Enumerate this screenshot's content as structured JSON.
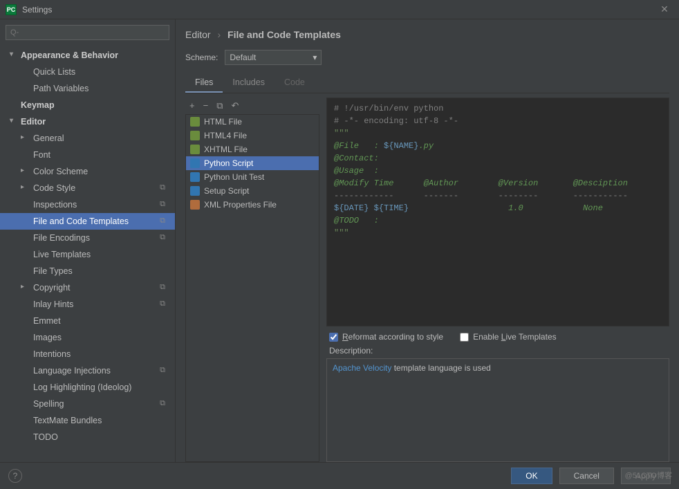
{
  "window": {
    "title": "Settings"
  },
  "search": {
    "placeholder": "Q-"
  },
  "sidebar": {
    "items": [
      {
        "label": "Appearance & Behavior",
        "level": 0,
        "exp": true
      },
      {
        "label": "Quick Lists",
        "level": 2
      },
      {
        "label": "Path Variables",
        "level": 2
      },
      {
        "label": "Keymap",
        "level": 0
      },
      {
        "label": "Editor",
        "level": 0,
        "exp": true
      },
      {
        "label": "General",
        "level": 1,
        "exp": true
      },
      {
        "label": "Font",
        "level": 2
      },
      {
        "label": "Color Scheme",
        "level": 1,
        "exp": true
      },
      {
        "label": "Code Style",
        "level": 1,
        "exp": true,
        "badge": "⧉"
      },
      {
        "label": "Inspections",
        "level": 2,
        "badge": "⧉"
      },
      {
        "label": "File and Code Templates",
        "level": 2,
        "badge": "⧉",
        "selected": true
      },
      {
        "label": "File Encodings",
        "level": 2,
        "badge": "⧉"
      },
      {
        "label": "Live Templates",
        "level": 2
      },
      {
        "label": "File Types",
        "level": 2
      },
      {
        "label": "Copyright",
        "level": 1,
        "exp": true,
        "badge": "⧉"
      },
      {
        "label": "Inlay Hints",
        "level": 2,
        "badge": "⧉"
      },
      {
        "label": "Emmet",
        "level": 2
      },
      {
        "label": "Images",
        "level": 2
      },
      {
        "label": "Intentions",
        "level": 2
      },
      {
        "label": "Language Injections",
        "level": 2,
        "badge": "⧉"
      },
      {
        "label": "Log Highlighting (Ideolog)",
        "level": 2
      },
      {
        "label": "Spelling",
        "level": 2,
        "badge": "⧉"
      },
      {
        "label": "TextMate Bundles",
        "level": 2
      },
      {
        "label": "TODO",
        "level": 2
      }
    ]
  },
  "breadcrumb": {
    "root": "Editor",
    "current": "File and Code Templates"
  },
  "scheme": {
    "label": "Scheme:",
    "value": "Default"
  },
  "tabs": [
    {
      "label": "Files",
      "active": true
    },
    {
      "label": "Includes"
    },
    {
      "label": "Code",
      "disabled": true
    }
  ],
  "toolbar": {
    "add": "+",
    "remove": "−",
    "copy": "⧉",
    "undo": "↶"
  },
  "files": [
    {
      "label": "HTML File",
      "icon": "html"
    },
    {
      "label": "HTML4 File",
      "icon": "html"
    },
    {
      "label": "XHTML File",
      "icon": "html"
    },
    {
      "label": "Python Script",
      "icon": "py",
      "selected": true
    },
    {
      "label": "Python Unit Test",
      "icon": "py"
    },
    {
      "label": "Setup Script",
      "icon": "py"
    },
    {
      "label": "XML Properties File",
      "icon": "xml"
    }
  ],
  "code": {
    "l1": "# !/usr/bin/env python",
    "l2": "# -*- encoding: utf-8 -*-",
    "l3": "\"\"\"",
    "l4a": "@File   : ",
    "l4b": "${NAME}",
    "l4c": ".py",
    "l5": "@Contact:",
    "l6": "@Usage  :",
    "l7a": "@Modify Time",
    "l7b": "@Author",
    "l7c": "@Version",
    "l7d": "@Desciption",
    "l8a": "------------",
    "l8b": "-------",
    "l8c": "--------",
    "l8d": "-----------",
    "l9a": "${DATE} ${TIME}",
    "l9b": "",
    "l9c": "1.0",
    "l9d": "None",
    "l10": "@TODO   :",
    "l11": "\"\"\""
  },
  "options": {
    "reformat": "Reformat according to style",
    "reformat_checked": true,
    "liveTpl": "Enable Live Templates",
    "liveTpl_checked": false
  },
  "description": {
    "label": "Description:",
    "link": "Apache Velocity",
    "rest": " template language is used"
  },
  "buttons": {
    "ok": "OK",
    "cancel": "Cancel",
    "apply": "Apply"
  },
  "watermark": "@51CTO博客"
}
